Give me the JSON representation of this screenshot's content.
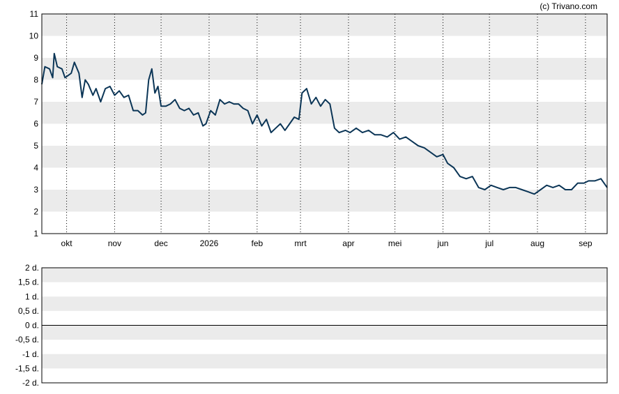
{
  "credit": "(c) Trivano.com",
  "colors": {
    "line": "#0b3556",
    "band": "#ebebeb",
    "grid": "#000000",
    "frame": "#000000"
  },
  "chart_data": [
    {
      "type": "line",
      "ylim": [
        1,
        11
      ],
      "y_ticks": [
        "1",
        "2",
        "3",
        "4",
        "5",
        "6",
        "7",
        "8",
        "9",
        "10",
        "11"
      ],
      "x_tick_labels": [
        "okt",
        "nov",
        "dec",
        "2026",
        "feb",
        "mrt",
        "apr",
        "mei",
        "jun",
        "jul",
        "aug",
        "sep"
      ],
      "x_range": [
        "2025-09-15",
        "2026-09-15"
      ],
      "x_tick_dates": [
        "2025-10-01",
        "2025-11-01",
        "2025-12-01",
        "2026-01-01",
        "2026-02-01",
        "2026-03-01",
        "2026-04-01",
        "2026-05-01",
        "2026-06-01",
        "2026-07-01",
        "2026-08-01",
        "2026-09-01"
      ],
      "grid": "vertical dotted at month starts, alternating horizontal bands",
      "series": [
        {
          "x": [
            "2025-09-15",
            "2025-09-17",
            "2025-09-20",
            "2025-09-22",
            "2025-09-23",
            "2025-09-25",
            "2025-09-28",
            "2025-09-30",
            "2025-10-02",
            "2025-10-04",
            "2025-10-06",
            "2025-10-09",
            "2025-10-11",
            "2025-10-13",
            "2025-10-15",
            "2025-10-18",
            "2025-10-20",
            "2025-10-23",
            "2025-10-26",
            "2025-10-29",
            "2025-11-01",
            "2025-11-04",
            "2025-11-07",
            "2025-11-10",
            "2025-11-13",
            "2025-11-16",
            "2025-11-19",
            "2025-11-21",
            "2025-11-23",
            "2025-11-25",
            "2025-11-27",
            "2025-11-29",
            "2025-12-01",
            "2025-12-04",
            "2025-12-07",
            "2025-12-10",
            "2025-12-13",
            "2025-12-16",
            "2025-12-19",
            "2025-12-22",
            "2025-12-25",
            "2025-12-28",
            "2025-12-30",
            "2026-01-02",
            "2026-01-05",
            "2026-01-08",
            "2026-01-11",
            "2026-01-14",
            "2026-01-17",
            "2026-01-20",
            "2026-01-23",
            "2026-01-26",
            "2026-01-29",
            "2026-02-01",
            "2026-02-04",
            "2026-02-07",
            "2026-02-10",
            "2026-02-13",
            "2026-02-16",
            "2026-02-19",
            "2026-02-22",
            "2026-02-25",
            "2026-02-28",
            "2026-03-02",
            "2026-03-05",
            "2026-03-08",
            "2026-03-11",
            "2026-03-14",
            "2026-03-17",
            "2026-03-20",
            "2026-03-23",
            "2026-03-26",
            "2026-03-30",
            "2026-04-02",
            "2026-04-06",
            "2026-04-10",
            "2026-04-14",
            "2026-04-18",
            "2026-04-22",
            "2026-04-26",
            "2026-04-30",
            "2026-05-04",
            "2026-05-08",
            "2026-05-12",
            "2026-05-16",
            "2026-05-20",
            "2026-05-24",
            "2026-05-28",
            "2026-06-01",
            "2026-06-04",
            "2026-06-08",
            "2026-06-12",
            "2026-06-16",
            "2026-06-20",
            "2026-06-24",
            "2026-06-28",
            "2026-07-02",
            "2026-07-06",
            "2026-07-10",
            "2026-07-14",
            "2026-07-18",
            "2026-07-22",
            "2026-07-26",
            "2026-07-30",
            "2026-08-03",
            "2026-08-07",
            "2026-08-11",
            "2026-08-15",
            "2026-08-19",
            "2026-08-23",
            "2026-08-27",
            "2026-08-31",
            "2026-09-03",
            "2026-09-07",
            "2026-09-11",
            "2026-09-15"
          ],
          "y": [
            7.8,
            8.6,
            8.5,
            8.1,
            9.2,
            8.6,
            8.5,
            8.1,
            8.2,
            8.3,
            8.8,
            8.3,
            7.2,
            8.0,
            7.8,
            7.3,
            7.6,
            7.0,
            7.6,
            7.7,
            7.3,
            7.5,
            7.2,
            7.3,
            6.6,
            6.6,
            6.4,
            6.5,
            8.0,
            8.5,
            7.4,
            7.7,
            6.8,
            6.8,
            6.9,
            7.1,
            6.7,
            6.6,
            6.7,
            6.4,
            6.5,
            5.9,
            6.0,
            6.6,
            6.4,
            7.1,
            6.9,
            7.0,
            6.9,
            6.9,
            6.7,
            6.6,
            6.0,
            6.4,
            5.9,
            6.2,
            5.6,
            5.8,
            6.0,
            5.7,
            6.0,
            6.3,
            6.2,
            7.4,
            7.6,
            6.9,
            7.2,
            6.8,
            7.1,
            6.9,
            5.8,
            5.6,
            5.7,
            5.6,
            5.8,
            5.6,
            5.7,
            5.5,
            5.5,
            5.4,
            5.6,
            5.3,
            5.4,
            5.2,
            5.0,
            4.9,
            4.7,
            4.5,
            4.6,
            4.2,
            4.0,
            3.6,
            3.5,
            3.6,
            3.1,
            3.0,
            3.2,
            3.1,
            3.0,
            3.1,
            3.1,
            3.0,
            2.9,
            2.8,
            3.0,
            3.2,
            3.1,
            3.2,
            3.0,
            3.0,
            3.3,
            3.3,
            3.4,
            3.4,
            3.5,
            3.1
          ]
        }
      ]
    },
    {
      "type": "bar",
      "ylim": [
        -2,
        2
      ],
      "y_ticks": [
        "2 d.",
        "1,5 d.",
        "1 d.",
        "0,5 d.",
        "0 d.",
        "-0,5 d.",
        "-1 d.",
        "-1,5 d.",
        "-2 d."
      ],
      "grid": "alternating horizontal bands, zero line",
      "series": []
    }
  ]
}
